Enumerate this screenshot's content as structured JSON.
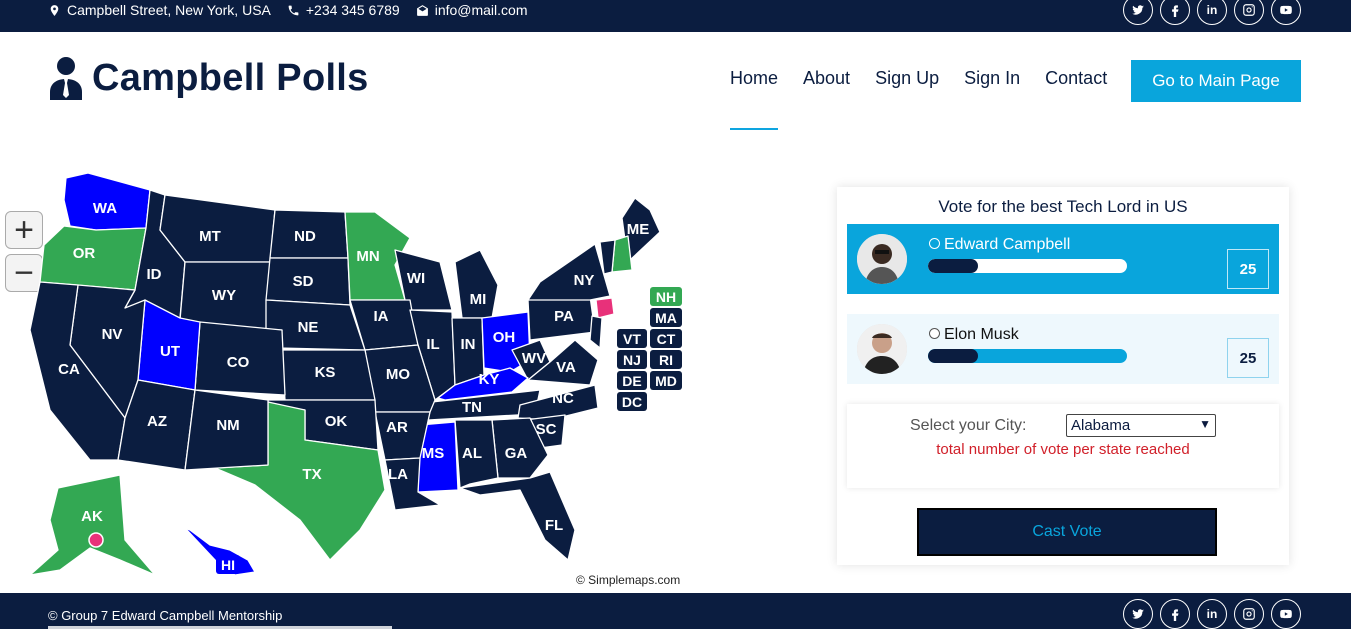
{
  "topbar": {
    "address": "Campbell Street, New York, USA",
    "phone": "+234 345 6789",
    "email": "info@mail.com",
    "social": [
      "twitter-icon",
      "facebook-icon",
      "linkedin-icon",
      "instagram-icon",
      "youtube-icon"
    ]
  },
  "header": {
    "logo_text": "Campbell Polls",
    "nav": [
      "Home",
      "About",
      "Sign Up",
      "Sign In",
      "Contact"
    ],
    "active_nav": "Home",
    "cta": "Go to Main Page"
  },
  "map": {
    "credit": "© Simplemaps.com",
    "colors": {
      "default": "#0b1d40",
      "green": "#33a853",
      "blue": "#0000ff",
      "pink": "#e8317a"
    },
    "states_green": [
      "OR",
      "MN",
      "TX",
      "AK",
      "ME",
      "NH"
    ],
    "states_blue": [
      "WA",
      "UT",
      "OH",
      "KY",
      "MS",
      "HI"
    ],
    "labels": [
      "WA",
      "OR",
      "MT",
      "ID",
      "ND",
      "SD",
      "MN",
      "WI",
      "MI",
      "NY",
      "ME",
      "WY",
      "NE",
      "IA",
      "IL",
      "IN",
      "OH",
      "PA",
      "NV",
      "UT",
      "CO",
      "KS",
      "MO",
      "KY",
      "WV",
      "VA",
      "CA",
      "AZ",
      "NM",
      "OK",
      "AR",
      "TN",
      "NC",
      "SC",
      "TX",
      "LA",
      "MS",
      "AL",
      "GA",
      "FL",
      "AK",
      "HI",
      "NH",
      "MA",
      "VT",
      "CT",
      "NJ",
      "RI",
      "DE",
      "MD",
      "DC"
    ]
  },
  "poll": {
    "title": "Vote for the best Tech Lord in US",
    "candidates": [
      {
        "name": "Edward Campbell",
        "votes": "25",
        "progress": 0.25,
        "selected": true
      },
      {
        "name": "Elon Musk",
        "votes": "25",
        "progress": 0.25,
        "selected": false
      }
    ],
    "city_label": "Select your City:",
    "city_value": "Alabama",
    "warning": "total number of vote per state reached",
    "cast_button": "Cast Vote"
  },
  "footer": {
    "copyright": "© Group 7 Edward Campbell Mentorship"
  },
  "colors": {
    "navy": "#0b1d40",
    "accent": "#09a5dc",
    "warning": "#d1202a"
  }
}
